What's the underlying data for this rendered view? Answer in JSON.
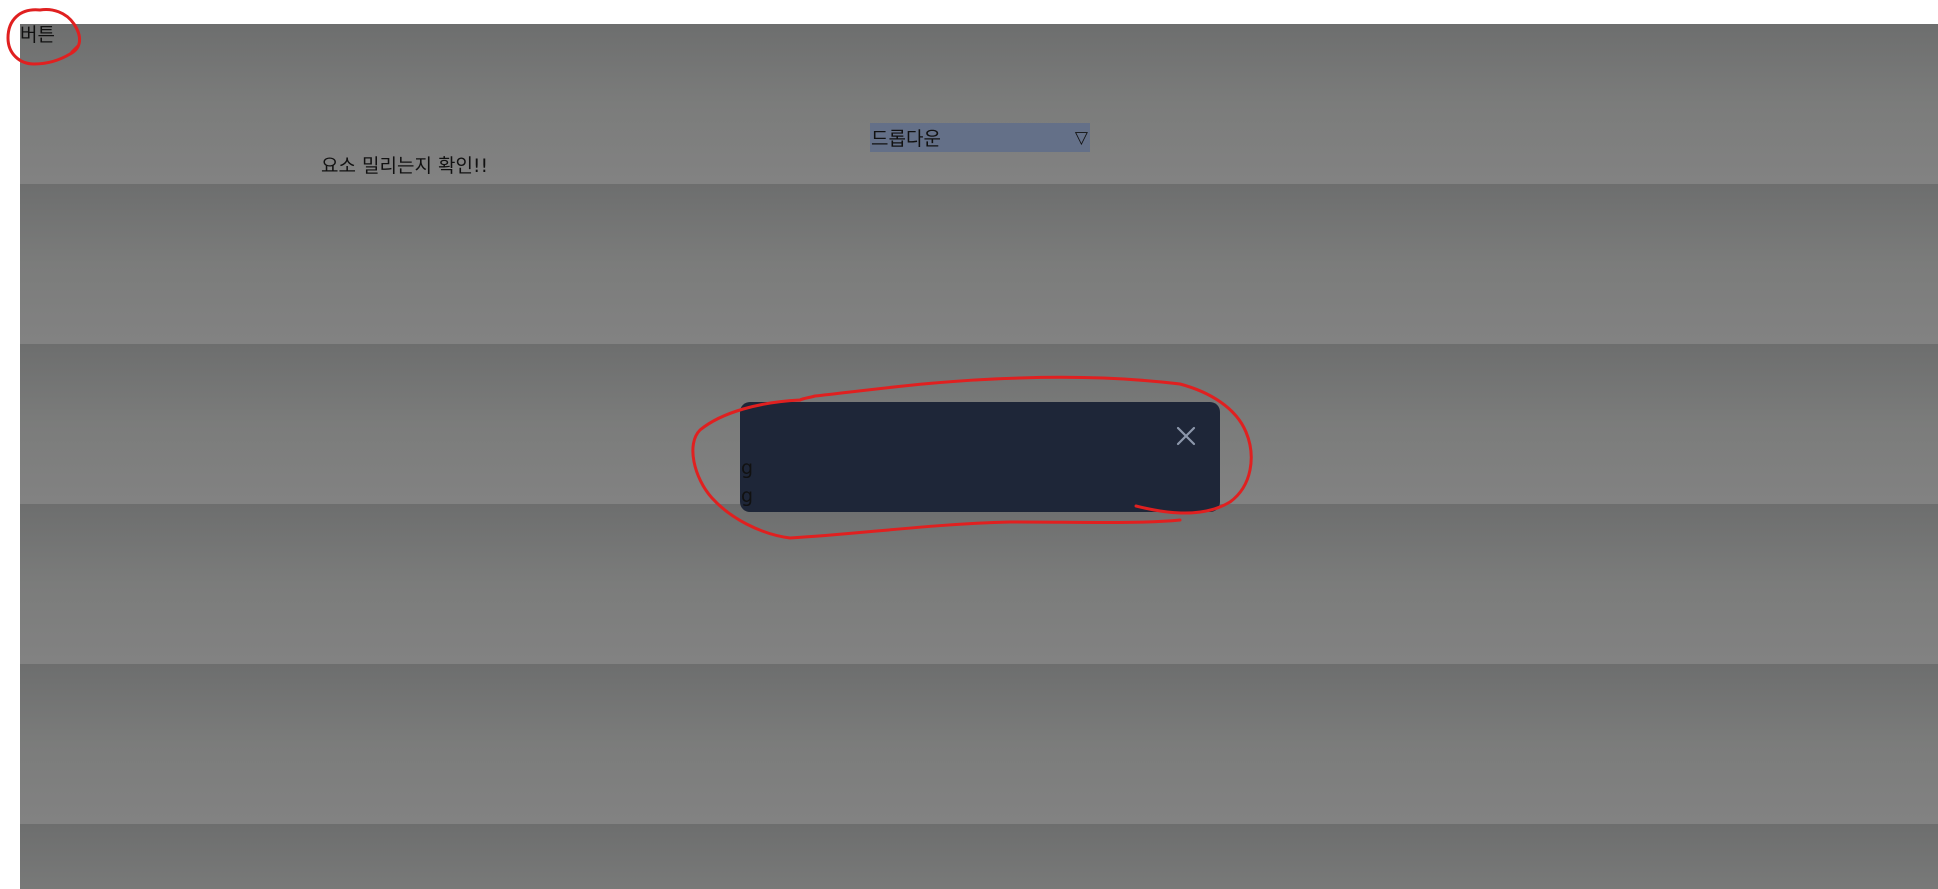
{
  "top_button": {
    "label": "버튼"
  },
  "dropdown": {
    "selected": "드롭다운",
    "arrow_glyph": "▽"
  },
  "check_text": "요소 밀리는지 확인!!",
  "modal": {
    "background": "#1e2638",
    "lines": [
      "g",
      "g"
    ],
    "close_icon": "close-icon"
  },
  "overlay_colors": [
    "#6d6e6e",
    "#828282"
  ],
  "annotation_color": "#e02020"
}
